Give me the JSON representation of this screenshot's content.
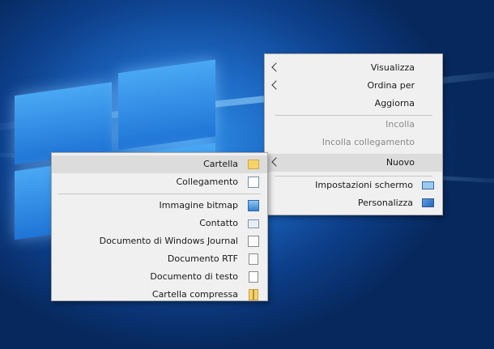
{
  "main_menu": {
    "items": [
      {
        "label": "Visualizza",
        "submenu": true
      },
      {
        "label": "Ordina per",
        "submenu": true
      },
      {
        "label": "Aggiorna"
      },
      {
        "label": "Incolla",
        "disabled": true
      },
      {
        "label": "Incolla collegamento",
        "disabled": true
      },
      {
        "label": "Nuovo",
        "submenu": true,
        "highlighted": true
      },
      {
        "label": "Impostazioni schermo",
        "icon": "display-icon"
      },
      {
        "label": "Personalizza",
        "icon": "personalize-icon"
      }
    ]
  },
  "new_submenu": {
    "items": [
      {
        "label": "Cartella",
        "icon": "folder-icon",
        "highlighted": true
      },
      {
        "label": "Collegamento",
        "icon": "shortcut-icon"
      },
      {
        "label": "Immagine bitmap",
        "icon": "bitmap-icon"
      },
      {
        "label": "Contatto",
        "icon": "contact-icon"
      },
      {
        "label": "Documento di Windows Journal",
        "icon": "journal-icon"
      },
      {
        "label": "Documento RTF",
        "icon": "rtf-icon"
      },
      {
        "label": "Documento di testo",
        "icon": "text-document-icon"
      },
      {
        "label": "Cartella compressa",
        "icon": "zip-folder-icon"
      }
    ]
  },
  "colors": {
    "menu_bg": "#f0f0f0",
    "highlight_bg": "#dcdcdc",
    "disabled_text": "#8a8a8a",
    "desktop_blue": "#1d69c4"
  }
}
